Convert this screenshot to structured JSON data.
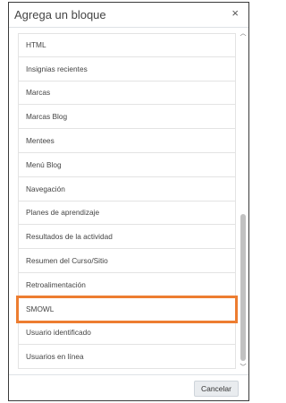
{
  "modal": {
    "title": "Agrega un bloque",
    "close_symbol": "×"
  },
  "blocks": [
    {
      "label": "HTML"
    },
    {
      "label": "Insignias recientes"
    },
    {
      "label": "Marcas"
    },
    {
      "label": "Marcas Blog"
    },
    {
      "label": "Mentees"
    },
    {
      "label": "Menú Blog"
    },
    {
      "label": "Navegación"
    },
    {
      "label": "Planes de aprendizaje"
    },
    {
      "label": "Resultados de la actividad"
    },
    {
      "label": "Resumen del Curso/Sitio"
    },
    {
      "label": "Retroalimentación"
    },
    {
      "label": "SMOWL",
      "highlighted": true
    },
    {
      "label": "Usuario identificado"
    },
    {
      "label": "Usuarios en línea"
    }
  ],
  "footer": {
    "cancel_label": "Cancelar"
  },
  "colors": {
    "highlight": "#ed7d31",
    "border": "#3a3a3a"
  }
}
